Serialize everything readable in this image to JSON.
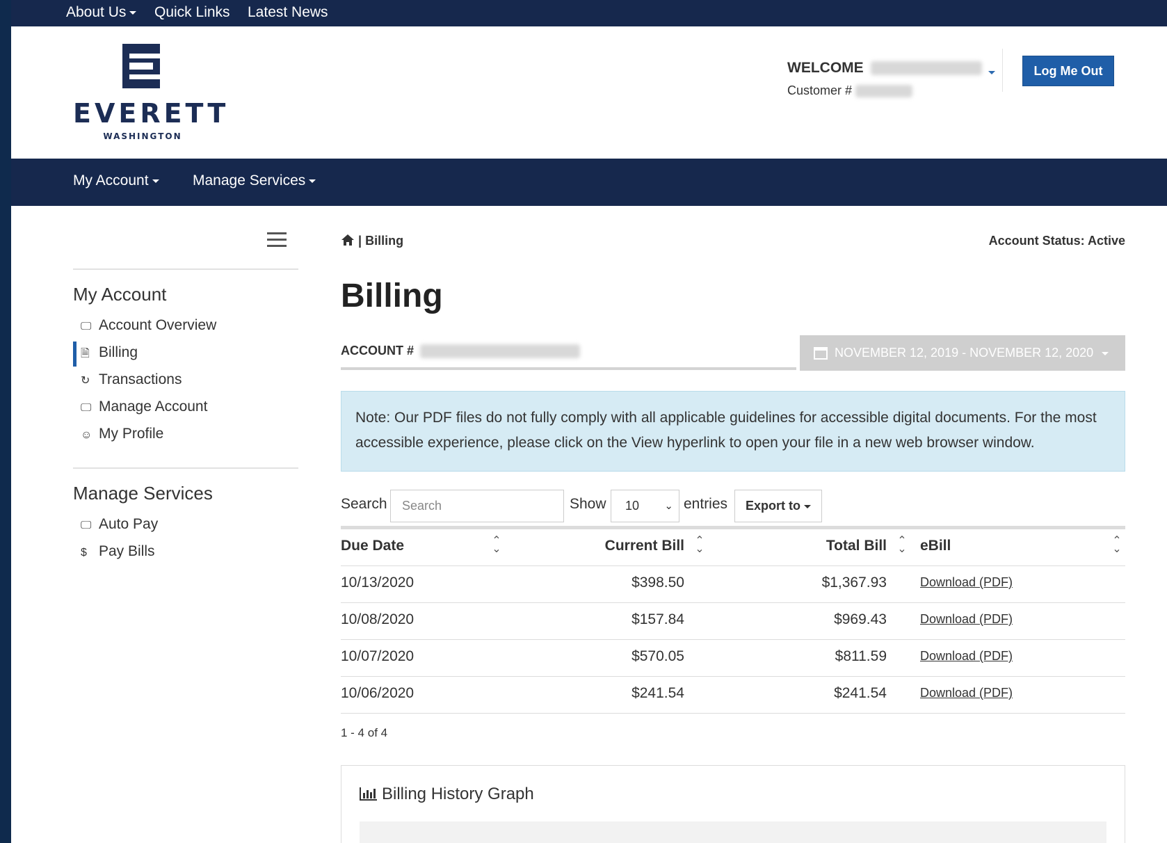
{
  "topbar": {
    "about_us": "About Us",
    "quick_links": "Quick Links",
    "latest_news": "Latest News"
  },
  "logo": {
    "name": "EVERETT",
    "subtitle": "WASHINGTON"
  },
  "header": {
    "welcome": "WELCOME",
    "customer_label": "Customer #",
    "logout_label": "Log Me Out"
  },
  "mainnav": {
    "my_account": "My Account",
    "manage_services": "Manage Services"
  },
  "sidebar": {
    "my_account_heading": "My Account",
    "my_account_items": [
      {
        "label": "Account Overview",
        "icon": "monitor-icon"
      },
      {
        "label": "Billing",
        "icon": "bill-icon"
      },
      {
        "label": "Transactions",
        "icon": "transactions-icon"
      },
      {
        "label": "Manage Account",
        "icon": "manage-account-icon"
      },
      {
        "label": "My Profile",
        "icon": "profile-icon"
      }
    ],
    "manage_services_heading": "Manage Services",
    "manage_services_items": [
      {
        "label": "Auto Pay",
        "icon": "autopay-icon"
      },
      {
        "label": "Pay Bills",
        "icon": "dollar-icon"
      }
    ]
  },
  "breadcrumb": {
    "sep": "|",
    "current": "Billing"
  },
  "account_status": "Account Status: Active",
  "page_title": "Billing",
  "account_label": "ACCOUNT #",
  "date_range": "NOVEMBER 12, 2019 - NOVEMBER 12, 2020",
  "note": "Note: Our PDF files do not fully comply with all applicable guidelines for accessible digital documents. For the most accessible experience, please click on the View hyperlink to open your file in a new web browser window.",
  "controls": {
    "search_label": "Search",
    "search_placeholder": "Search",
    "show_label": "Show",
    "show_value": "10",
    "entries_label": "entries",
    "export_label": "Export to"
  },
  "table": {
    "headers": [
      "Due Date",
      "Current Bill",
      "Total Bill",
      "eBill"
    ],
    "rows": [
      [
        "10/13/2020",
        "$398.50",
        "$1,367.93",
        "Download (PDF)"
      ],
      [
        "10/08/2020",
        "$157.84",
        "$969.43",
        "Download (PDF)"
      ],
      [
        "10/07/2020",
        "$570.05",
        "$811.59",
        "Download (PDF)"
      ],
      [
        "10/06/2020",
        "$241.54",
        "$241.54",
        "Download (PDF)"
      ]
    ]
  },
  "pagination": "1 - 4 of 4",
  "graph_title": "Billing History Graph",
  "colors": {
    "navy": "#16284d",
    "accent": "#1f5ea8",
    "note_bg": "#d6ebf4"
  }
}
